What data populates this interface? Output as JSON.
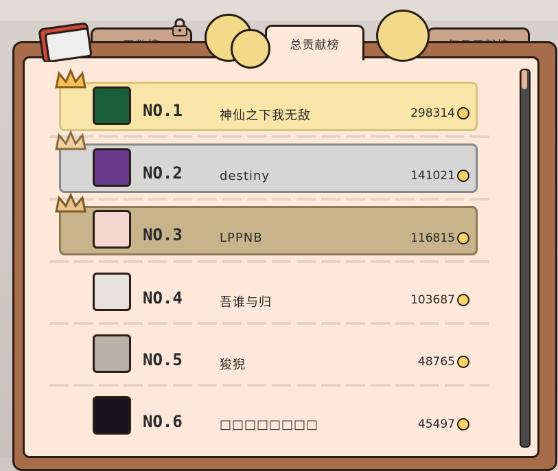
{
  "tabs": [
    {
      "label": "天数榜",
      "active": false
    },
    {
      "label": "总贡献榜",
      "active": true
    },
    {
      "label": "每日贡献榜",
      "active": false
    }
  ],
  "leaderboard": [
    {
      "rank": "NO.1",
      "name": "神仙之下我无敌",
      "score": "298314",
      "tier": "gold"
    },
    {
      "rank": "NO.2",
      "name": "destiny",
      "score": "141021",
      "tier": "silver"
    },
    {
      "rank": "NO.3",
      "name": "LPPNB",
      "score": "116815",
      "tier": "bronze"
    },
    {
      "rank": "NO.4",
      "name": "吾谁与归",
      "score": "103687",
      "tier": "none"
    },
    {
      "rank": "NO.5",
      "name": "狻猊",
      "score": "48765",
      "tier": "none"
    },
    {
      "rank": "NO.6",
      "name": "□□□□□□□□",
      "score": "45497",
      "tier": "none"
    }
  ],
  "colors": {
    "gold": "#f8e6a8",
    "silver": "#d6d6d6",
    "bronze": "#c8b48b",
    "paper": "#fde8da",
    "board": "#a76d4a"
  },
  "icons": {
    "currency": "paw-coin-icon",
    "tab_lock": "lock-icon"
  }
}
